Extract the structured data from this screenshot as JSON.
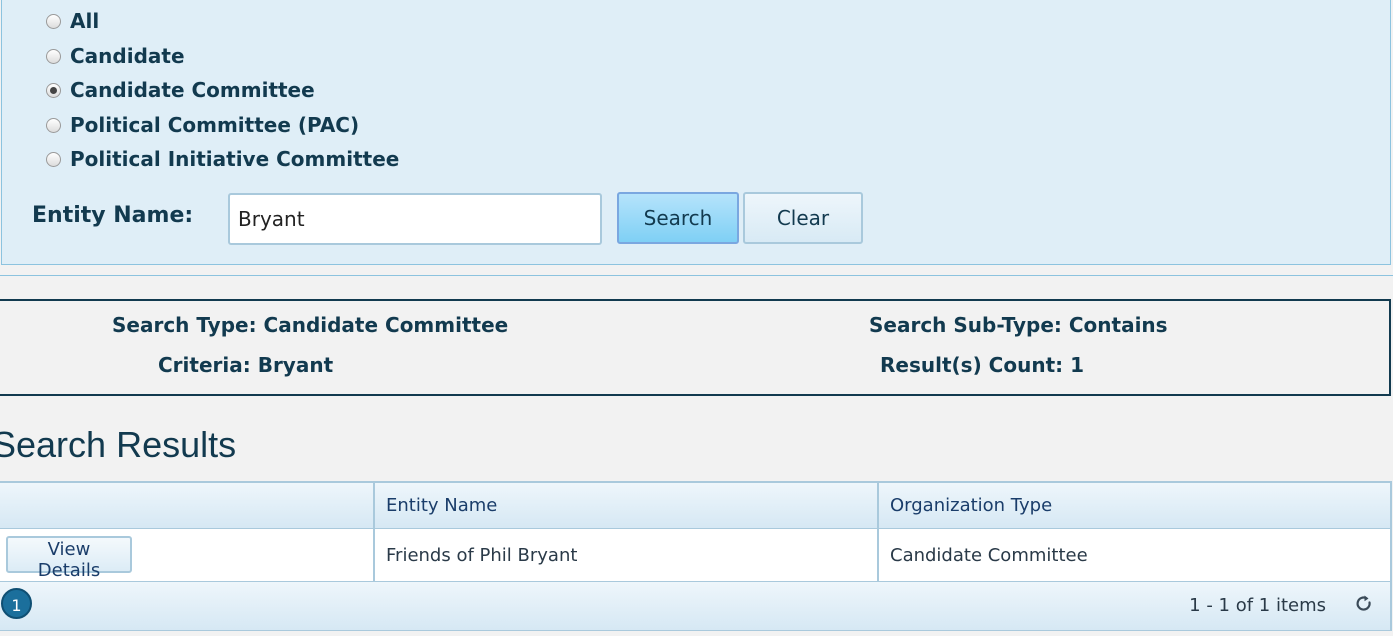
{
  "filter": {
    "options": [
      {
        "label": "All",
        "checked": false
      },
      {
        "label": "Candidate",
        "checked": false
      },
      {
        "label": "Candidate Committee",
        "checked": true
      },
      {
        "label": "Political Committee (PAC)",
        "checked": false
      },
      {
        "label": "Political Initiative Committee",
        "checked": false
      }
    ],
    "entity_label": "Entity Name:",
    "entity_value": "Bryant",
    "search_label": "Search",
    "clear_label": "Clear"
  },
  "summary": {
    "search_type": "Search Type: Candidate Committee",
    "criteria": "Criteria: Bryant",
    "sub_type": "Search Sub-Type:  Contains",
    "count": "Result(s) Count: 1"
  },
  "results": {
    "title": "Search Results",
    "columns": [
      "",
      "Entity Name",
      "Organization Type"
    ],
    "rows": [
      {
        "action": "View Details",
        "entity_name": "Friends of Phil Bryant",
        "org_type": "Candidate Committee"
      }
    ],
    "pager": {
      "current_page": "1",
      "info": "1 - 1 of 1 items",
      "refresh_icon": "refresh-icon"
    }
  }
}
